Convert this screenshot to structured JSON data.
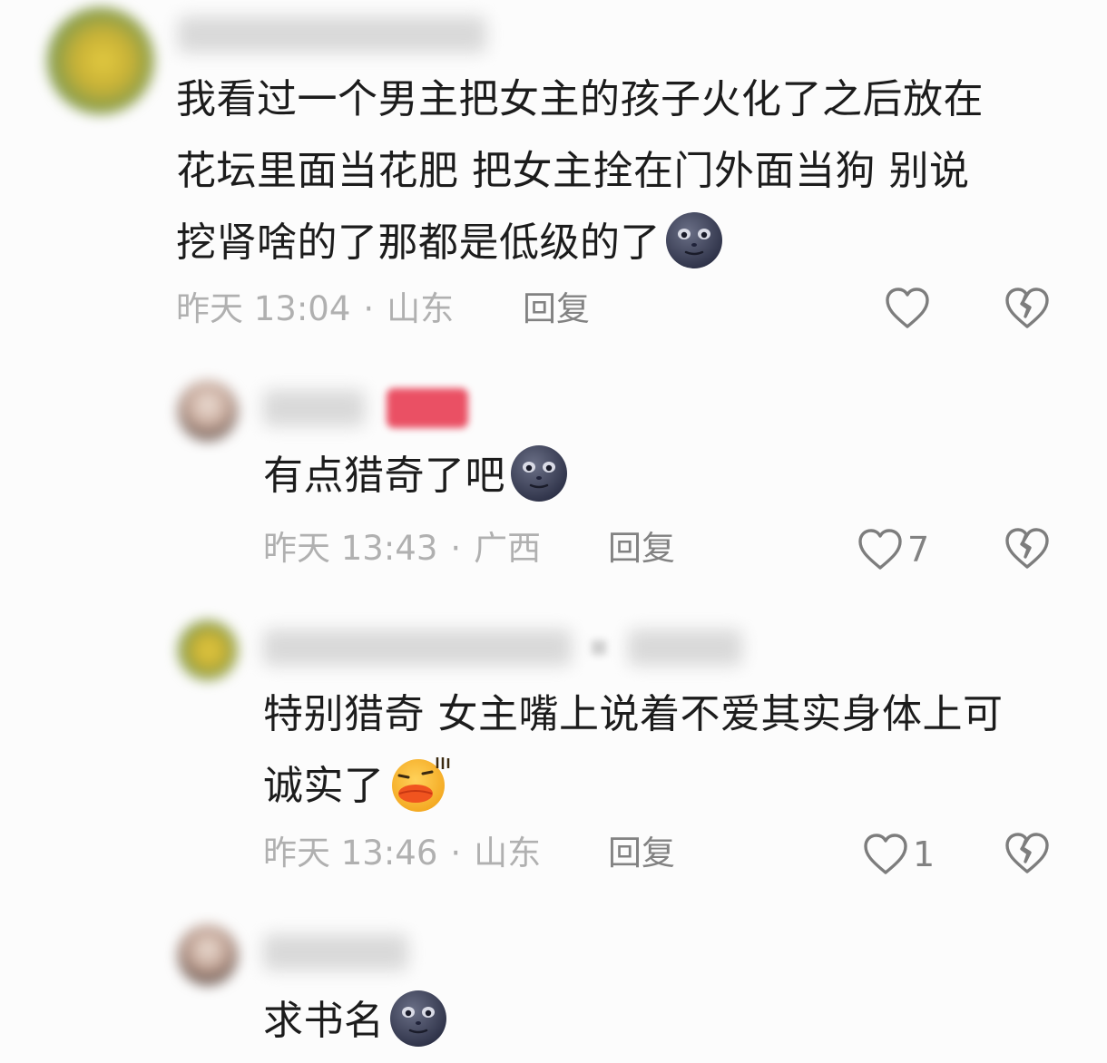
{
  "comments": [
    {
      "lines": [
        "我看过一个男主把女主的孩子火化了之后放在",
        "花坛里面当花肥 把女主拴在门外面当狗 别说",
        "挖肾啥的了那都是低级的了"
      ],
      "emoji": "new-moon-face-emoji",
      "time": "昨天 13:04",
      "location": "山东",
      "reply_label": "回复",
      "likes": ""
    },
    {
      "lines": [
        "有点猎奇了吧"
      ],
      "emoji": "new-moon-face-emoji",
      "time": "昨天 13:43",
      "location": "广西",
      "reply_label": "回复",
      "likes": "7"
    },
    {
      "lines": [
        "特别猎奇 女主嘴上说着不爱其实身体上可",
        "诚实了"
      ],
      "emoji": "blushing-duck-emoji",
      "time": "昨天 13:46",
      "location": "山东",
      "reply_label": "回复",
      "likes": "1"
    },
    {
      "lines": [
        "求书名"
      ],
      "emoji": "new-moon-face-emoji"
    }
  ],
  "meta_separator": "·",
  "colors": {
    "text": "#1c1c1c",
    "meta": "#b0b0b0",
    "action": "#828282",
    "author_badge": "#ea5064"
  }
}
